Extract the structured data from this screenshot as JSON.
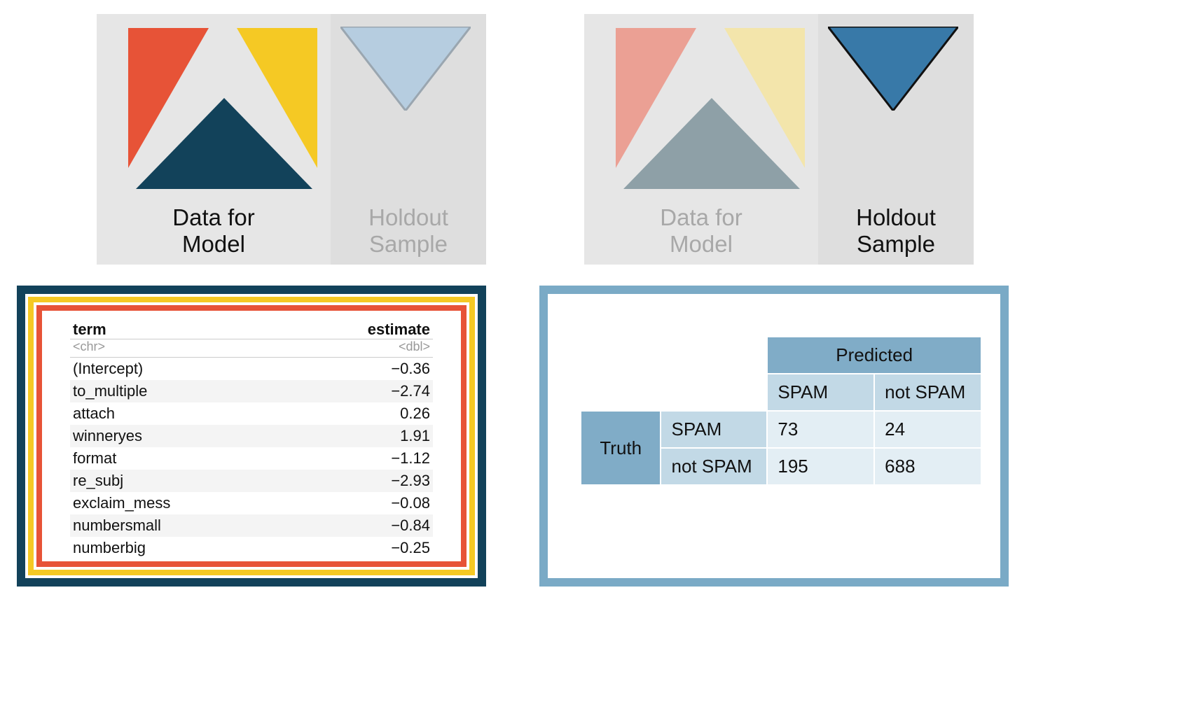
{
  "left": {
    "model_label": "Data for\nModel",
    "holdout_label": "Holdout\nSample"
  },
  "right": {
    "model_label": "Data for\nModel",
    "holdout_label": "Holdout\nSample"
  },
  "coef_table": {
    "header_term": "term",
    "header_est": "estimate",
    "type_term": "<chr>",
    "type_est": "<dbl>",
    "rows": [
      {
        "term": "(Intercept)",
        "estimate": "−0.36"
      },
      {
        "term": "to_multiple",
        "estimate": "−2.74"
      },
      {
        "term": "attach",
        "estimate": "0.26"
      },
      {
        "term": "winneryes",
        "estimate": "1.91"
      },
      {
        "term": "format",
        "estimate": "−1.12"
      },
      {
        "term": "re_subj",
        "estimate": "−2.93"
      },
      {
        "term": "exclaim_mess",
        "estimate": "−0.08"
      },
      {
        "term": "numbersmall",
        "estimate": "−0.84"
      },
      {
        "term": "numberbig",
        "estimate": "−0.25"
      }
    ]
  },
  "confusion": {
    "predicted_label": "Predicted",
    "truth_label": "Truth",
    "col_spam": "SPAM",
    "col_notspam": "not SPAM",
    "row_spam": "SPAM",
    "row_notspam": "not SPAM",
    "cells": {
      "tp": "73",
      "fn": "24",
      "fp": "195",
      "tn": "688"
    }
  },
  "chart_data": [
    {
      "type": "table",
      "title": "Model coefficient estimates",
      "columns": [
        "term",
        "estimate"
      ],
      "rows": [
        [
          "(Intercept)",
          -0.36
        ],
        [
          "to_multiple",
          -2.74
        ],
        [
          "attach",
          0.26
        ],
        [
          "winneryes",
          1.91
        ],
        [
          "format",
          -1.12
        ],
        [
          "re_subj",
          -2.93
        ],
        [
          "exclaim_mess",
          -0.08
        ],
        [
          "numbersmall",
          -0.84
        ],
        [
          "numberbig",
          -0.25
        ]
      ]
    },
    {
      "type": "table",
      "title": "Confusion matrix (Truth vs Predicted)",
      "columns": [
        "",
        "Predicted SPAM",
        "Predicted not SPAM"
      ],
      "rows": [
        [
          "Truth SPAM",
          73,
          24
        ],
        [
          "Truth not SPAM",
          195,
          688
        ]
      ]
    }
  ]
}
